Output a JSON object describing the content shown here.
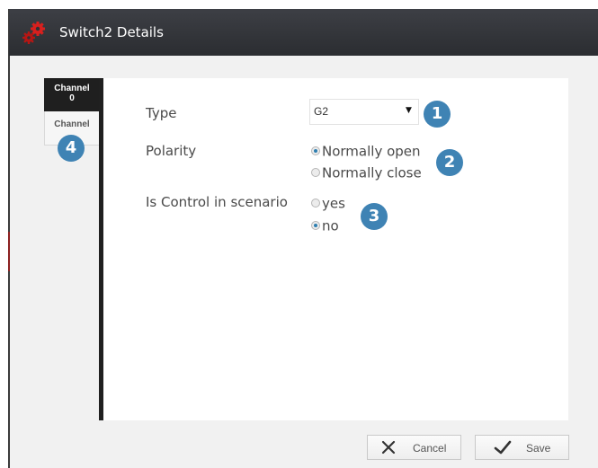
{
  "window": {
    "title": "Switch2 Details",
    "icon": "red-gears-icon"
  },
  "tabs": [
    {
      "label": "Channel",
      "sub": "0",
      "active": true
    },
    {
      "label": "Channel",
      "sub": "",
      "active": false
    }
  ],
  "form": {
    "type": {
      "label": "Type",
      "value": "G2"
    },
    "polarity": {
      "label": "Polarity",
      "options": [
        "Normally open",
        "Normally close"
      ],
      "selected": "Normally open"
    },
    "control": {
      "label": "Is Control in scenario",
      "options": [
        "yes",
        "no"
      ],
      "selected": "no"
    }
  },
  "callouts": [
    "1",
    "2",
    "3",
    "4"
  ],
  "buttons": {
    "cancel": "Cancel",
    "save": "Save"
  },
  "colors": {
    "titlebar": "#2f3136",
    "badge": "#3f83b4",
    "accent_radio": "#2f7fb0",
    "active_tab": "#1f1f1f"
  }
}
